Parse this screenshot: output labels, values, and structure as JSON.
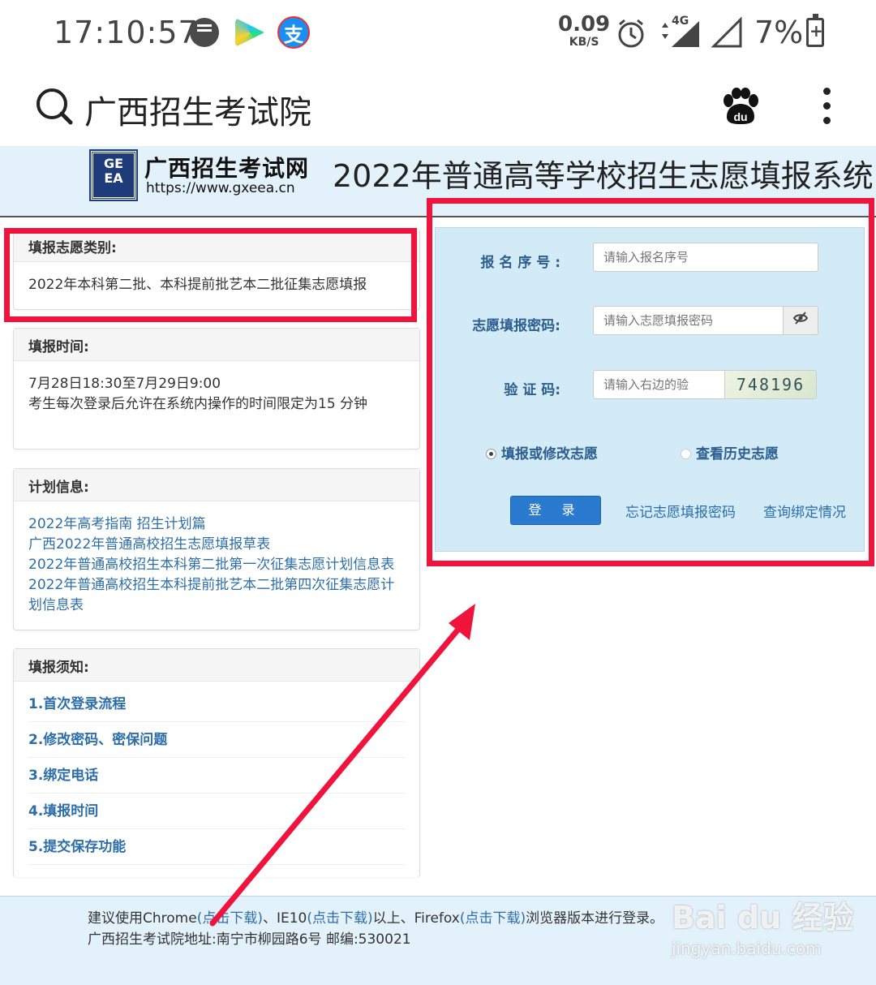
{
  "status_bar": {
    "time": "17:10:57",
    "net_speed": "0.09",
    "net_speed_unit": "KB/S",
    "signal_label": "4G",
    "battery": "7%",
    "pay_app_glyph": "支"
  },
  "search_bar": {
    "query": "广西招生考试院",
    "icons": [
      "search-icon",
      "baidu-paw-icon",
      "more-vert-icon"
    ]
  },
  "site_header": {
    "logo_mark": "GE EA",
    "site_name": "广西招生考试网",
    "site_url": "https://www.gxeea.cn",
    "system_title": "2022年普通高等学校招生志愿填报系统"
  },
  "panels": {
    "category": {
      "heading": "填报志愿类别:",
      "text": "2022年本科第二批、本科提前批艺本二批征集志愿填报"
    },
    "time": {
      "heading": "填报时间:",
      "line1": "7月28日18:30至7月29日9:00",
      "line2": "考生每次登录后允许在系统内操作的时间限定为15 分钟"
    },
    "plan": {
      "heading": "计划信息:",
      "links": [
        "2022年高考指南 招生计划篇",
        "广西2022年普通高校招生志愿填报草表",
        "2022年普通高校招生本科第二批第一次征集志愿计划信息表",
        "2022年普通高校招生本科提前批艺本二批第四次征集志愿计划信息表"
      ]
    },
    "notes": {
      "heading": "填报须知:",
      "items": [
        "1.首次登录流程",
        "2.修改密码、密保问题",
        "3.绑定电话",
        "4.填报时间",
        "5.提交保存功能"
      ]
    }
  },
  "login_form": {
    "reg_label": "报 名 序 号 :",
    "reg_placeholder": "请输入报名序号",
    "pwd_label": "志愿填报密码:",
    "pwd_placeholder": "请输入志愿填报密码",
    "captcha_label": "验 证 码:",
    "captcha_placeholder": "请输入右边的验",
    "captcha_value": "748196",
    "radio_fill": "填报或修改志愿",
    "radio_history": "查看历史志愿",
    "radio_selected": "填报或修改志愿",
    "login_button": "登 录",
    "forgot_link": "忘记志愿填报密码",
    "binding_link": "查询绑定情况"
  },
  "footer": {
    "line1_a": "建议使用Chrome",
    "line1_dl1": "(点击下载)",
    "line1_b": "、IE10",
    "line1_dl2": "(点击下载)",
    "line1_c": "以上、Firefox",
    "line1_dl3": "(点击下载)",
    "line1_d": "浏览器版本进行登录。",
    "line2": "广西招生考试院地址:南宁市柳园路6号    邮编:530021"
  },
  "watermark": {
    "logo": "Bai du 经验",
    "url": "jingyan.baidu.com"
  },
  "colors": {
    "annotation_red": "#f0143c",
    "header_bg": "#e3f1fb",
    "form_bg": "#d3ebf7",
    "link_blue": "#2d6ea8",
    "button_blue": "#2a7ad0"
  }
}
